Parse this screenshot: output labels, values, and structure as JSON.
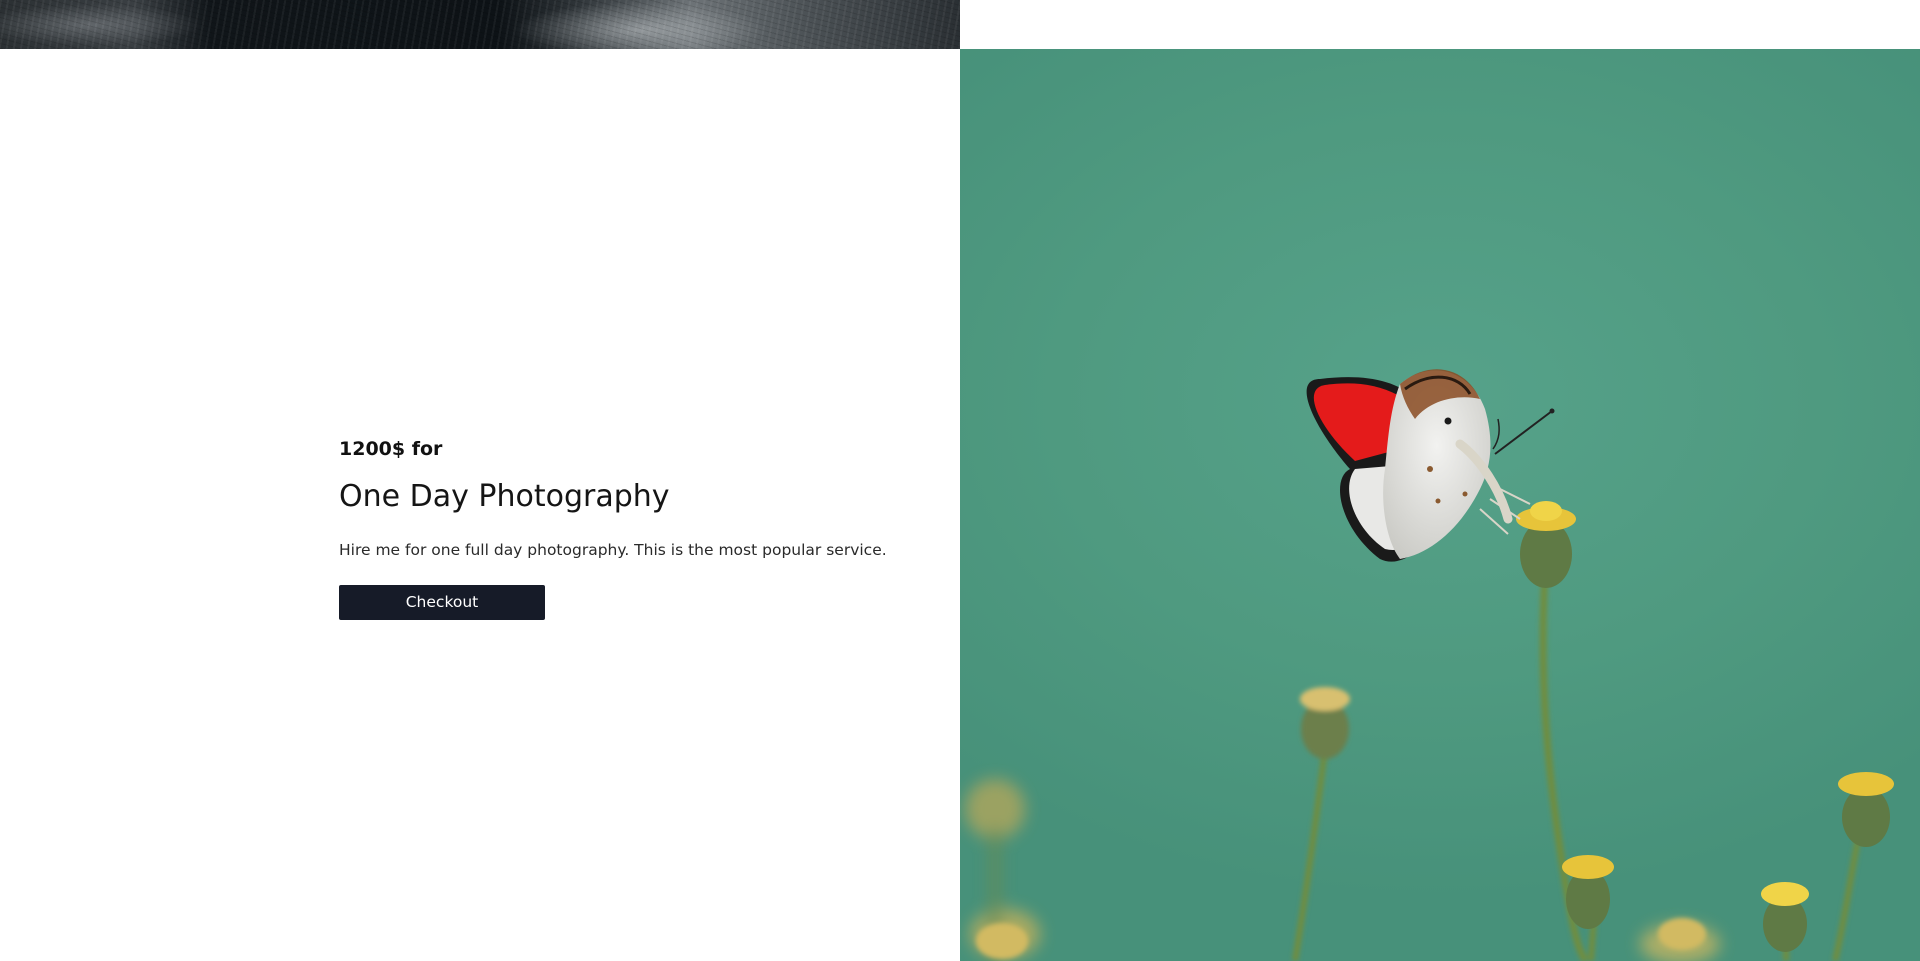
{
  "offer": {
    "price": "1200$ for",
    "title": "One Day Photography",
    "description": "Hire me for one full day photography. This is the most popular service.",
    "checkout_label": "Checkout"
  },
  "colors": {
    "button_bg": "#161b28",
    "photo_bg": "#4f9a80"
  }
}
